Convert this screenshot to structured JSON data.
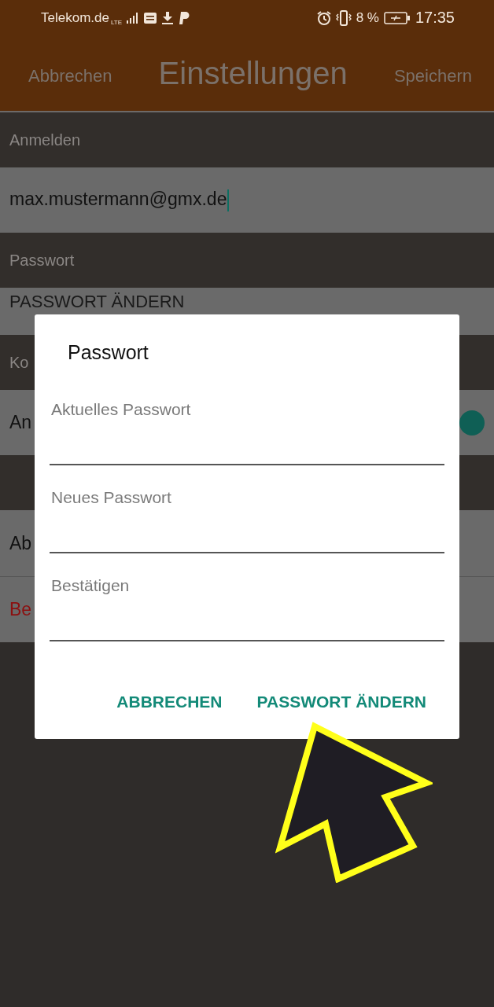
{
  "status_bar": {
    "carrier": "Telekom.de",
    "network": "LTE",
    "battery": "8 %",
    "time": "17:35"
  },
  "app_bar": {
    "cancel": "Abbrechen",
    "title": "Einstellungen",
    "save": "Speichern"
  },
  "settings": [
    {
      "kind": "header",
      "label": "Anmelden"
    },
    {
      "kind": "input",
      "value": "max.mustermann@gmx.de",
      "focused": true
    },
    {
      "kind": "header",
      "label": "Passwort"
    },
    {
      "kind": "button",
      "label": "PASSWORT ÄNDERN"
    },
    {
      "kind": "header",
      "label": "Ko"
    },
    {
      "kind": "toggle",
      "label": "An",
      "on": true
    },
    {
      "kind": "spacer"
    },
    {
      "kind": "item",
      "label": "Ab"
    },
    {
      "kind": "danger",
      "label": "Be"
    }
  ],
  "dialog": {
    "title": "Passwort",
    "fields": [
      {
        "placeholder": "Aktuelles Passwort"
      },
      {
        "placeholder": "Neues Passwort"
      },
      {
        "placeholder": "Bestätigen"
      }
    ],
    "buttons": [
      "ABBRECHEN",
      "PASSWORT ÄNDERN"
    ]
  }
}
